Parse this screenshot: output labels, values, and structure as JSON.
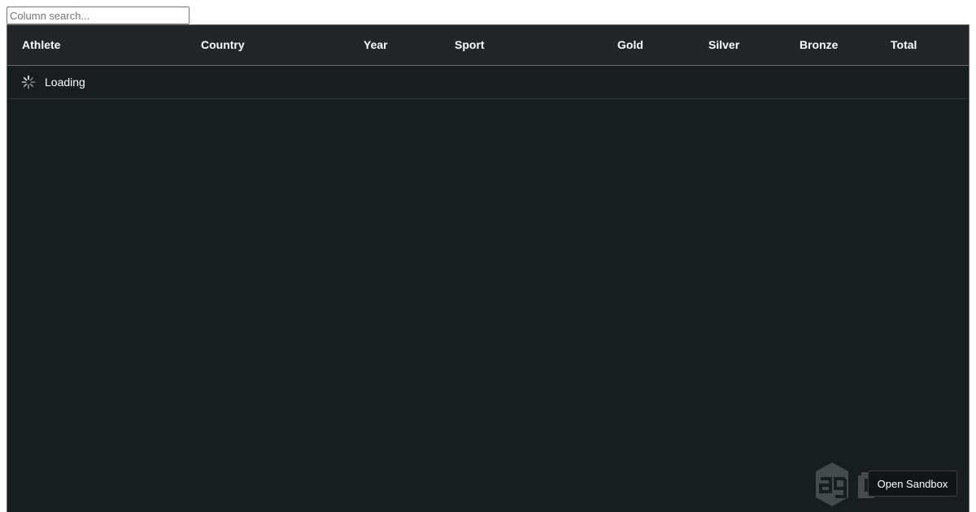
{
  "search": {
    "placeholder": "Column search...",
    "value": ""
  },
  "grid": {
    "columns": [
      "Athlete",
      "Country",
      "Year",
      "Sport",
      "Gold",
      "Silver",
      "Bronze",
      "Total"
    ],
    "loading_label": "Loading"
  },
  "sandbox": {
    "label": "Open Sandbox"
  },
  "colors": {
    "grid_background": "#181d1f",
    "header_background": "#222628",
    "border": "#68686e",
    "text": "#ffffff"
  },
  "icons": {
    "loading": "loading-spinner-icon",
    "watermark": "ag-grid-logo-icon"
  }
}
